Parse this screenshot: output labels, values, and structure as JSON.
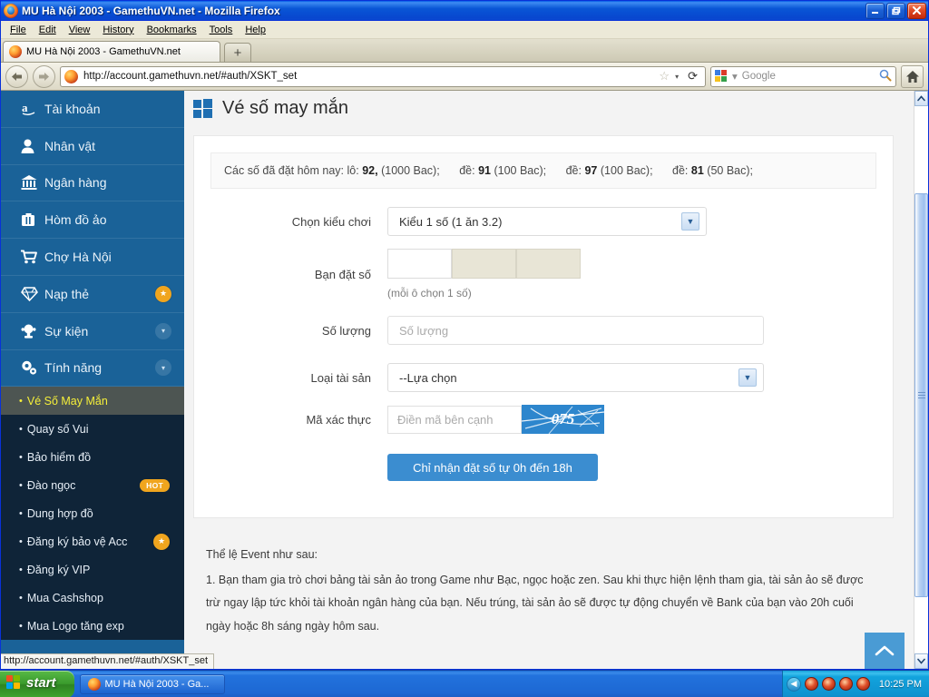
{
  "window": {
    "title": "MU Hà Nội 2003 - GamethuVN.net - Mozilla Firefox",
    "minimize_label": "–",
    "maximize_label": "❐",
    "close_label": "✕"
  },
  "menubar": {
    "items": [
      "File",
      "Edit",
      "View",
      "History",
      "Bookmarks",
      "Tools",
      "Help"
    ]
  },
  "tabs": {
    "active_tab_label": "MU Hà Nội 2003 - GamethuVN.net",
    "new_tab_label": "+"
  },
  "navbar": {
    "back_label": "◄",
    "forward_label": "►",
    "url": "http://account.gamethuvn.net/#auth/XSKT_set",
    "star_label": "☆",
    "caret_label": "▾",
    "reload_label": "⟳",
    "search_placeholder": "Google",
    "search_caret": "▾",
    "search_go_label": "🔍",
    "home_label": "⌂"
  },
  "sidebar": {
    "items": [
      {
        "label": "Tài khoản",
        "icon": "amazon-a-icon",
        "glyph": "a",
        "badge": ""
      },
      {
        "label": "Nhân vật",
        "icon": "user-icon",
        "glyph": "@",
        "badge": ""
      },
      {
        "label": "Ngân hàng",
        "icon": "bank-icon",
        "glyph": "@",
        "badge": ""
      },
      {
        "label": "Hòm đồ ảo",
        "icon": "briefcase-icon",
        "glyph": "@",
        "badge": ""
      },
      {
        "label": "Chợ Hà Nội",
        "icon": "shopping-cart-icon",
        "glyph": "@",
        "badge": ""
      },
      {
        "label": "Nạp thẻ",
        "icon": "diamond-icon",
        "glyph": "@",
        "badge": "star"
      },
      {
        "label": "Sự kiện",
        "icon": "trophy-icon",
        "glyph": "@",
        "badge": "chevron"
      },
      {
        "label": "Tính năng",
        "icon": "gears-icon",
        "glyph": "@",
        "badge": "chevron"
      }
    ],
    "badge_star_label": "★",
    "badge_chevron_label": "▾",
    "submenu": [
      {
        "label": "Vé Số May Mắn",
        "active": true,
        "badge": ""
      },
      {
        "label": "Quay số Vui",
        "active": false,
        "badge": ""
      },
      {
        "label": "Bảo hiểm đồ",
        "active": false,
        "badge": ""
      },
      {
        "label": "Đào ngọc",
        "active": false,
        "badge": "HOT"
      },
      {
        "label": "Dung hợp đồ",
        "active": false,
        "badge": ""
      },
      {
        "label": "Đăng ký bảo vệ Acc",
        "active": false,
        "badge": "star"
      },
      {
        "label": "Đăng ký VIP",
        "active": false,
        "badge": ""
      },
      {
        "label": "Mua Cashshop",
        "active": false,
        "badge": ""
      },
      {
        "label": "Mua Logo tăng exp",
        "active": false,
        "badge": ""
      }
    ],
    "bullet": "•"
  },
  "main": {
    "page_title": "Vé số may mắn",
    "numbers_bar": {
      "prefix": "Các số đã đặt hôm nay:",
      "entries": [
        {
          "type": "lô:",
          "number": "92,",
          "amount": "(1000 Bac);"
        },
        {
          "type": "đề:",
          "number": "91",
          "amount": "(100 Bac);"
        },
        {
          "type": "đề:",
          "number": "97",
          "amount": "(100 Bac);"
        },
        {
          "type": "đề:",
          "number": "81",
          "amount": "(50 Bac);"
        }
      ]
    },
    "form": {
      "play_type_label": "Chọn kiểu chơi",
      "play_type_value": "Kiểu 1 số (1 ăn 3.2)",
      "bet_number_label": "Bạn đặt số",
      "bet_boxes": [
        {
          "value": "",
          "disabled": false
        },
        {
          "value": "",
          "disabled": true
        },
        {
          "value": "",
          "disabled": true
        }
      ],
      "bet_hint": "(mỗi ô chọn 1 số)",
      "quantity_label": "Số lượng",
      "quantity_placeholder": "Số lượng",
      "quantity_value": "",
      "asset_label": "Loại tài sản",
      "asset_value": "--Lựa chọn",
      "captcha_label": "Mã xác thực",
      "captcha_placeholder": "Điền mã bên cạnh",
      "captcha_value": "",
      "captcha_code": "075",
      "submit_label": "Chỉ nhận đặt số tự 0h đến 18h"
    },
    "rules": {
      "heading": "Thể lệ Event như sau:",
      "item1": "1. Bạn tham gia trò chơi bảng tài sản ảo trong Game như Bạc, ngọc hoặc zen. Sau khi thực hiện lệnh tham gia, tài sản ảo sẽ được trừ ngay lập tức khỏi tài khoản ngân hàng của bạn. Nếu trúng, tài sản ảo sẽ được tự động chuyển về Bank của bạn vào 20h cuối ngày hoặc 8h sáng ngày hôm sau."
    },
    "scroll_top_label": "︿"
  },
  "scrollbar": {
    "up_label": "▲",
    "down_label": "▼"
  },
  "statusbar": {
    "text": "http://account.gamethuvn.net/#auth/XSKT_set"
  },
  "taskbar": {
    "start_label": "start",
    "items": [
      {
        "label": "MU Hà Nội 2003 - Ga..."
      }
    ],
    "tray_chevron": "◀",
    "tray_icons": 4,
    "clock": "10:25 PM"
  },
  "colors": {
    "sidebar_blue": "#1a6298",
    "submenu_navy": "#0f2438",
    "accent_orange": "#f0a51e",
    "button_blue": "#3b8dd0",
    "active_yellow": "#f5ef3a"
  }
}
